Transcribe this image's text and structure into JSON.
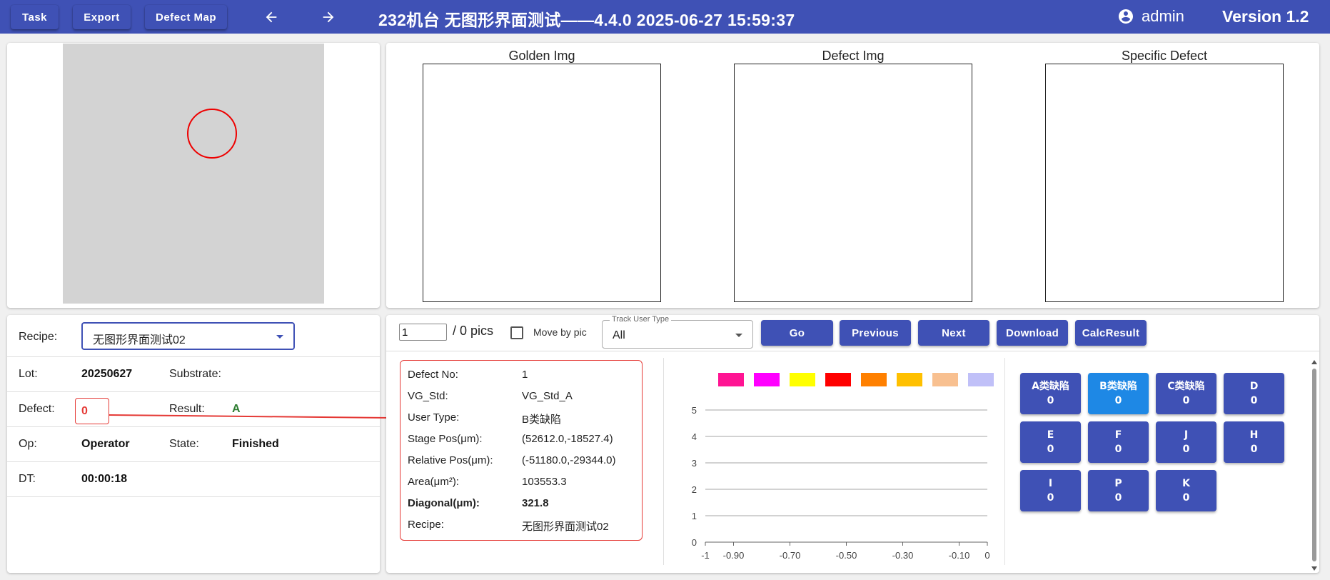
{
  "header": {
    "buttons": [
      "Task",
      "Export",
      "Defect Map"
    ],
    "title": "232机台  无图形界面测试——4.4.0  2025-06-27 15:59:37",
    "user": "admin",
    "version": "Version 1.2"
  },
  "images": {
    "golden": "Golden Img",
    "defect": "Defect Img",
    "specific": "Specific Defect"
  },
  "info": {
    "recipe_label": "Recipe:",
    "recipe_value": "无图形界面测试02",
    "lot_label": "Lot:",
    "lot_value": "20250627",
    "substrate_label": "Substrate:",
    "substrate_value": "",
    "defect_label": "Defect:",
    "defect_value": "0",
    "result_label": "Result:",
    "result_value": "A",
    "op_label": "Op:",
    "op_value": "Operator",
    "state_label": "State:",
    "state_value": "Finished",
    "dt_label": "DT:",
    "dt_value": "00:00:18"
  },
  "toolbar": {
    "page_value": "1",
    "pics_text": "/ 0 pics",
    "move_label": "Move by pic",
    "track_legend": "Track User Type",
    "track_value": "All",
    "go": "Go",
    "previous": "Previous",
    "next": "Next",
    "download": "Download",
    "calc": "CalcResult"
  },
  "details": {
    "rows": [
      {
        "label": "Defect No:",
        "value": "1"
      },
      {
        "label": "VG_Std:",
        "value": "VG_Std_A"
      },
      {
        "label": "User Type:",
        "value": "B类缺陷"
      },
      {
        "label": "Stage Pos(μm):",
        "value": "(52612.0,-18527.4)"
      },
      {
        "label": "Relative Pos(μm):",
        "value": "(-51180.0,-29344.0)"
      },
      {
        "label": "Area(μm²):",
        "value": "103553.3"
      },
      {
        "label": "Diagonal(μm):",
        "value": "321.8"
      },
      {
        "label": "Recipe:",
        "value": "无图形界面测试02"
      }
    ]
  },
  "chart_data": {
    "type": "scatter",
    "series": [],
    "legend_colors": [
      "#ff1493",
      "#ff00ff",
      "#ffff00",
      "#ff0000",
      "#ff8000",
      "#ffc000",
      "#f8c090",
      "#c0c0f8"
    ],
    "yticks": [
      "0",
      "1",
      "2",
      "3",
      "4",
      "5"
    ],
    "xticks": [
      "-1",
      "-0.90",
      "-0.70",
      "-0.50",
      "-0.30",
      "-0.10",
      "0"
    ],
    "ylim": [
      0,
      5
    ],
    "xlim": [
      -1,
      0
    ],
    "grid": true
  },
  "categories": [
    {
      "name": "A类缺陷",
      "count": "0"
    },
    {
      "name": "B类缺陷",
      "count": "0"
    },
    {
      "name": "C类缺陷",
      "count": "0"
    },
    {
      "name": "D",
      "count": "0"
    },
    {
      "name": "E",
      "count": "0"
    },
    {
      "name": "F",
      "count": "0"
    },
    {
      "name": "J",
      "count": "0"
    },
    {
      "name": "H",
      "count": "0"
    },
    {
      "name": "I",
      "count": "0"
    },
    {
      "name": "P",
      "count": "0"
    },
    {
      "name": "K",
      "count": "0"
    }
  ]
}
